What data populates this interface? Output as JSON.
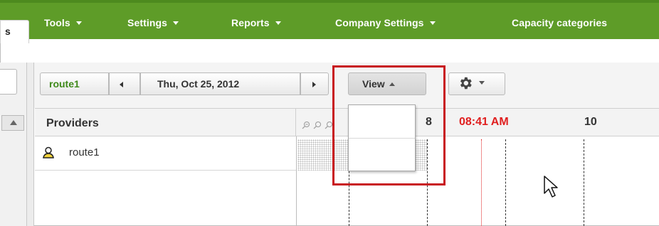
{
  "nav": {
    "stub_label": "s",
    "items": [
      {
        "label": "Tools"
      },
      {
        "label": "Settings"
      },
      {
        "label": "Reports"
      },
      {
        "label": "Company Settings"
      },
      {
        "label": "Capacity categories"
      }
    ]
  },
  "toolbar": {
    "route_label": "route1",
    "date_label": "Thu, Oct 25, 2012",
    "view_label": "View"
  },
  "view_menu": {
    "state": "open",
    "items": [
      "",
      ""
    ]
  },
  "grid": {
    "providers_header": "Providers",
    "time_labels": [
      "8",
      "08:41 AM",
      "10"
    ],
    "rows": [
      {
        "icon": "person-icon",
        "label": "route1"
      }
    ]
  },
  "colors": {
    "nav_green": "#5e9c28",
    "route_green": "#3f8a1a",
    "current_time_red": "#e01f1f",
    "highlight_red": "#c8161d"
  },
  "icons": [
    "chevron-left-icon",
    "chevron-right-icon",
    "gear-icon",
    "zoom-out-icon",
    "zoom-in-icon",
    "person-icon",
    "mouse-pointer-icon"
  ]
}
